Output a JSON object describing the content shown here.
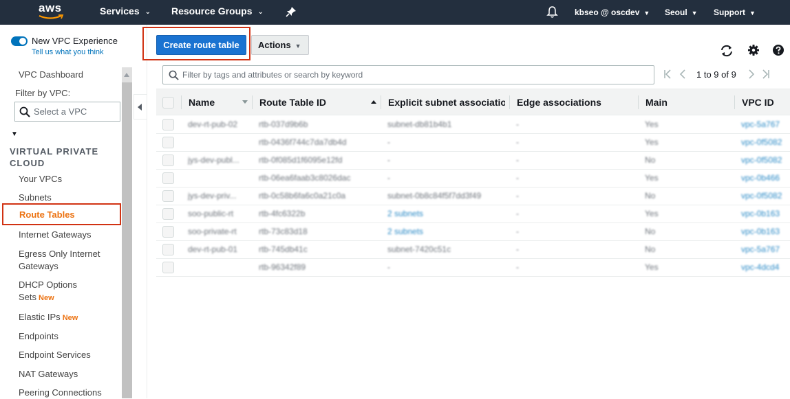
{
  "topnav": {
    "logo_text": "aws",
    "services": "Services",
    "resource_groups": "Resource Groups",
    "user": "kbseo @ oscdev",
    "region": "Seoul",
    "support": "Support"
  },
  "sidebar": {
    "new_vpc_experience": "New VPC Experience",
    "tell_us": "Tell us what you think",
    "dashboard": "VPC Dashboard",
    "filter_label": "Filter by VPC:",
    "filter_placeholder": "Select a VPC",
    "section_title": "VIRTUAL PRIVATE CLOUD",
    "new_badge": "New",
    "items": [
      {
        "label": "Your VPCs"
      },
      {
        "label": "Subnets"
      },
      {
        "label": "Route Tables"
      },
      {
        "label": "Internet Gateways"
      },
      {
        "label": "Egress Only Internet Gateways"
      },
      {
        "label": "DHCP Options Sets"
      },
      {
        "label": "Elastic IPs"
      },
      {
        "label": "Endpoints"
      },
      {
        "label": "Endpoint Services"
      },
      {
        "label": "NAT Gateways"
      },
      {
        "label": "Peering Connections"
      }
    ],
    "egress_line1": "Egress Only Internet",
    "egress_line2": "Gateways",
    "dhcp_line1": "DHCP Options",
    "dhcp_line2": "Sets"
  },
  "toolbar": {
    "create_label": "Create route table",
    "actions_label": "Actions"
  },
  "search": {
    "placeholder": "Filter by tags and attributes or search by keyword"
  },
  "pagination": {
    "text": "1 to 9 of 9"
  },
  "table": {
    "columns": [
      "Name",
      "Route Table ID",
      "Explicit subnet association",
      "Edge associations",
      "Main",
      "VPC ID"
    ],
    "rows": [
      {
        "name": "dev-rt-pub-02",
        "rt": "rtb-037d9b6b",
        "subnet": "subnet-db81b4b1",
        "edge": "-",
        "main": "Yes",
        "vpc": "vpc-5a767"
      },
      {
        "name": "",
        "rt": "rtb-0436f744c7da7db4d",
        "subnet": "-",
        "edge": "-",
        "main": "Yes",
        "vpc": "vpc-0f5082"
      },
      {
        "name": "jys-dev-publ...",
        "rt": "rtb-0f085d1f6095e12fd",
        "subnet": "-",
        "edge": "-",
        "main": "No",
        "vpc": "vpc-0f5082"
      },
      {
        "name": "",
        "rt": "rtb-06ea6faab3c8026dac",
        "subnet": "-",
        "edge": "-",
        "main": "Yes",
        "vpc": "vpc-0b466"
      },
      {
        "name": "jys-dev-priv...",
        "rt": "rtb-0c58b6fa6c0a21c0a",
        "subnet": "subnet-0b8c84f5f7dd3f49",
        "edge": "-",
        "main": "No",
        "vpc": "vpc-0f5082"
      },
      {
        "name": "soo-public-rt",
        "rt": "rtb-4fc6322b",
        "subnet": "2 subnets",
        "edge": "-",
        "main": "Yes",
        "vpc": "vpc-0b163"
      },
      {
        "name": "soo-private-rt",
        "rt": "rtb-73c83d18",
        "subnet": "2 subnets",
        "edge": "-",
        "main": "No",
        "vpc": "vpc-0b163"
      },
      {
        "name": "dev-rt-pub-01",
        "rt": "rtb-745db41c",
        "subnet": "subnet-7420c51c",
        "edge": "-",
        "main": "No",
        "vpc": "vpc-5a767"
      },
      {
        "name": "",
        "rt": "rtb-96342f89",
        "subnet": "-",
        "edge": "-",
        "main": "Yes",
        "vpc": "vpc-4dcd4"
      }
    ]
  },
  "colors": {
    "nav_bg": "#232f3e",
    "primary_button": "#1a73d1",
    "active_link": "#ec7211",
    "highlight_border": "#d13212",
    "link": "#0073bb"
  }
}
